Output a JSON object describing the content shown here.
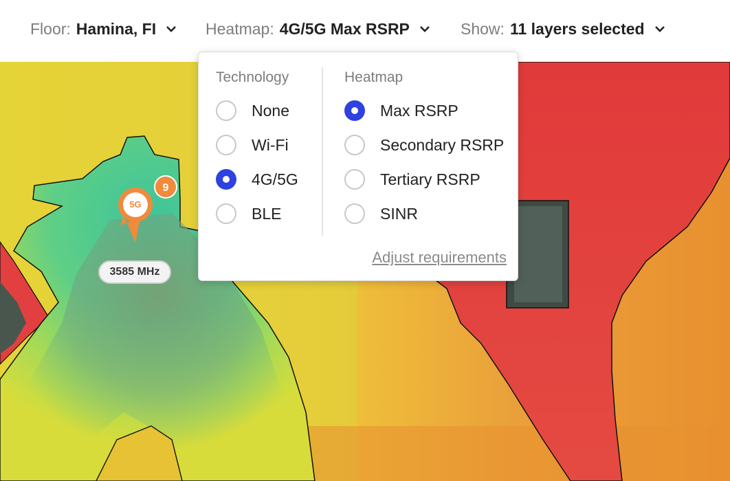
{
  "toolbar": {
    "floor": {
      "label": "Floor:",
      "value": "Hamina, FI"
    },
    "heatmap": {
      "label": "Heatmap:",
      "value": "4G/5G Max RSRP"
    },
    "show": {
      "label": "Show:",
      "value": "11 layers selected"
    },
    "dropdown_icon": "chevron-down-icon"
  },
  "dropdown": {
    "technology": {
      "title": "Technology",
      "options": [
        {
          "label": "None",
          "selected": false
        },
        {
          "label": "Wi-Fi",
          "selected": false
        },
        {
          "label": "4G/5G",
          "selected": true
        },
        {
          "label": "BLE",
          "selected": false
        }
      ]
    },
    "heatmap": {
      "title": "Heatmap",
      "options": [
        {
          "label": "Max RSRP",
          "selected": true
        },
        {
          "label": "Secondary RSRP",
          "selected": false
        },
        {
          "label": "Tertiary RSRP",
          "selected": false
        },
        {
          "label": "SINR",
          "selected": false
        }
      ]
    },
    "adjust_link": "Adjust requirements",
    "accent_color": "#2e42e0"
  },
  "map": {
    "access_point": {
      "badge": "5G",
      "count": "9",
      "frequency": "3585 MHz",
      "color": "#f08a3c"
    },
    "colors": {
      "strong": "#3ec49a",
      "good": "#c8d83a",
      "medium": "#f2c530",
      "weak": "#e8952e",
      "poor": "#e53b3b"
    }
  }
}
